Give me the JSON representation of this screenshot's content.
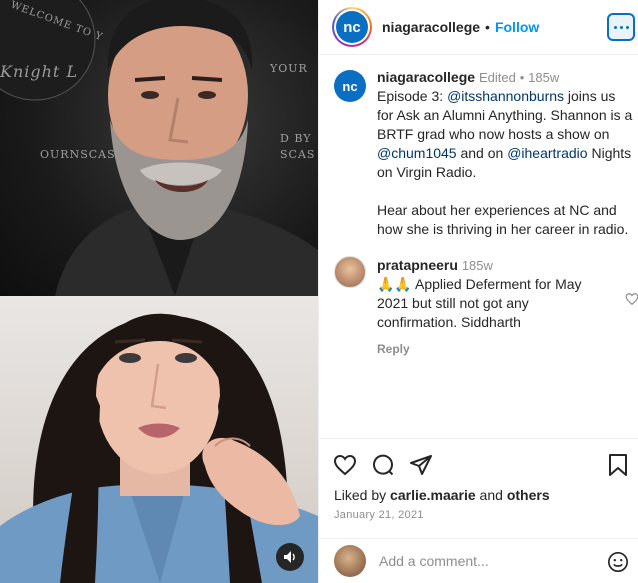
{
  "header": {
    "username": "niagaracollege",
    "separator": "•",
    "follow_label": "Follow",
    "logo_text": "nc"
  },
  "caption": {
    "avatar_text": "nc",
    "username": "niagaracollege",
    "edited": "Edited",
    "separator": "•",
    "time": "185w",
    "text_1": "Episode 3: ",
    "mention_1": "@itsshannonburns",
    "text_2": " joins us for Ask an Alumni Anything. Shannon is a BRTF grad who now hosts a show on ",
    "mention_2": "@chum1045",
    "text_3": " and on ",
    "mention_3": "@iheartradio",
    "text_4": " Nights on Virgin Radio.",
    "text_5": "Hear about her experiences at NC and how she is thriving in her career in radio."
  },
  "comment": {
    "username": "pratapneeru",
    "time": "185w",
    "emoji": "🙏🙏",
    "text": "Applied Deferment for May 2021 but still not got any confirmation. Siddharth",
    "reply_label": "Reply"
  },
  "actions": {
    "liked_by_prefix": "Liked by ",
    "liked_by_user": "carlie.maarie",
    "liked_by_mid": " and ",
    "liked_by_others": "others",
    "date": "January 21, 2021"
  },
  "add_comment": {
    "placeholder": "Add a comment..."
  },
  "media": {
    "wall_text_1": "WELCOME TO Y",
    "wall_text_2": "Knight L",
    "wall_text_3": "YOUR",
    "wall_text_4": "D BY",
    "wall_text_5": "OURNSCAS",
    "wall_text_6": "SCAS"
  },
  "colors": {
    "accent": "#0095f6",
    "brand": "#0a6fc2",
    "muted": "#8e8e8e"
  }
}
